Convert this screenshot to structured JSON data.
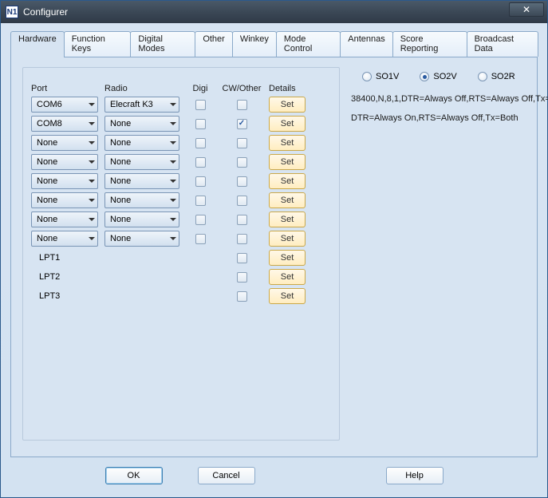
{
  "window": {
    "title": "Configurer"
  },
  "tabs": [
    {
      "label": "Hardware",
      "active": true
    },
    {
      "label": "Function Keys"
    },
    {
      "label": "Digital Modes"
    },
    {
      "label": "Other"
    },
    {
      "label": "Winkey"
    },
    {
      "label": "Mode Control"
    },
    {
      "label": "Antennas"
    },
    {
      "label": "Score Reporting"
    },
    {
      "label": "Broadcast Data"
    }
  ],
  "headers": {
    "port": "Port",
    "radio": "Radio",
    "digi": "Digi",
    "cw": "CW/Other",
    "details": "Details"
  },
  "rows": [
    {
      "port": "COM6",
      "radio": "Elecraft K3",
      "digi": false,
      "cw": false,
      "set": "Set",
      "detail": "38400,N,8,1,DTR=Always Off,RTS=Always Off,Tx="
    },
    {
      "port": "COM8",
      "radio": "None",
      "digi": false,
      "cw": true,
      "set": "Set",
      "detail": "DTR=Always On,RTS=Always Off,Tx=Both"
    },
    {
      "port": "None",
      "radio": "None",
      "digi": false,
      "cw": false,
      "set": "Set"
    },
    {
      "port": "None",
      "radio": "None",
      "digi": false,
      "cw": false,
      "set": "Set"
    },
    {
      "port": "None",
      "radio": "None",
      "digi": false,
      "cw": false,
      "set": "Set"
    },
    {
      "port": "None",
      "radio": "None",
      "digi": false,
      "cw": false,
      "set": "Set"
    },
    {
      "port": "None",
      "radio": "None",
      "digi": false,
      "cw": false,
      "set": "Set"
    },
    {
      "port": "None",
      "radio": "None",
      "digi": false,
      "cw": false,
      "set": "Set"
    },
    {
      "portLabel": "LPT1",
      "cw": false,
      "set": "Set"
    },
    {
      "portLabel": "LPT2",
      "cw": false,
      "set": "Set"
    },
    {
      "portLabel": "LPT3",
      "cw": false,
      "set": "Set"
    }
  ],
  "so_mode": {
    "options": [
      "SO1V",
      "SO2V",
      "SO2R"
    ],
    "selected": "SO2V"
  },
  "buttons": {
    "ok": "OK",
    "cancel": "Cancel",
    "help": "Help"
  },
  "appicon_text": "N1"
}
